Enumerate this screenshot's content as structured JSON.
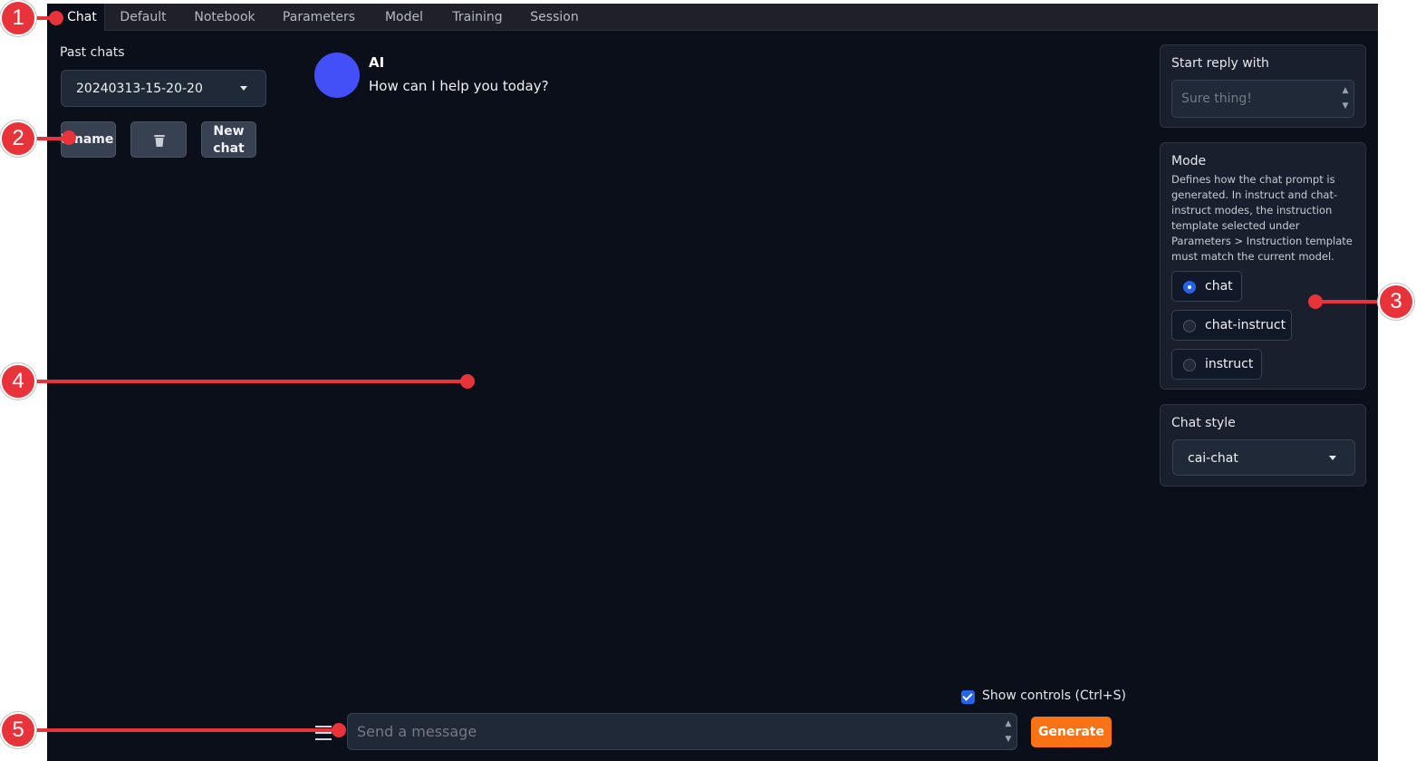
{
  "tabs": [
    {
      "label": "Chat"
    },
    {
      "label": "Default"
    },
    {
      "label": "Notebook"
    },
    {
      "label": "Parameters"
    },
    {
      "label": "Model"
    },
    {
      "label": "Training"
    },
    {
      "label": "Session"
    }
  ],
  "past_chats": {
    "label": "Past chats",
    "selected": "20240313-15-20-20",
    "rename_label": "Rename",
    "delete_icon": "trash-icon",
    "new_chat_line1": "New",
    "new_chat_line2": "chat"
  },
  "chat": {
    "ai_name": "AI",
    "message": "How can I help you today?",
    "avatar_color": "#4350f7"
  },
  "start_reply": {
    "title": "Start reply with",
    "placeholder": "Sure thing!"
  },
  "mode": {
    "title": "Mode",
    "description": "Defines how the chat prompt is generated. In instruct and chat-instruct modes, the instruction template selected under Parameters > Instruction template must match the current model.",
    "options": [
      {
        "label": "chat",
        "selected": true
      },
      {
        "label": "chat-instruct",
        "selected": false
      },
      {
        "label": "instruct",
        "selected": false
      }
    ]
  },
  "chat_style": {
    "title": "Chat style",
    "selected": "cai-chat"
  },
  "controls": {
    "show_controls_label": "Show controls (Ctrl+S)",
    "show_controls_checked": true,
    "message_placeholder": "Send a message",
    "generate_label": "Generate",
    "generate_color": "#f97316"
  },
  "annotations": [
    "1",
    "2",
    "3",
    "4",
    "5"
  ]
}
